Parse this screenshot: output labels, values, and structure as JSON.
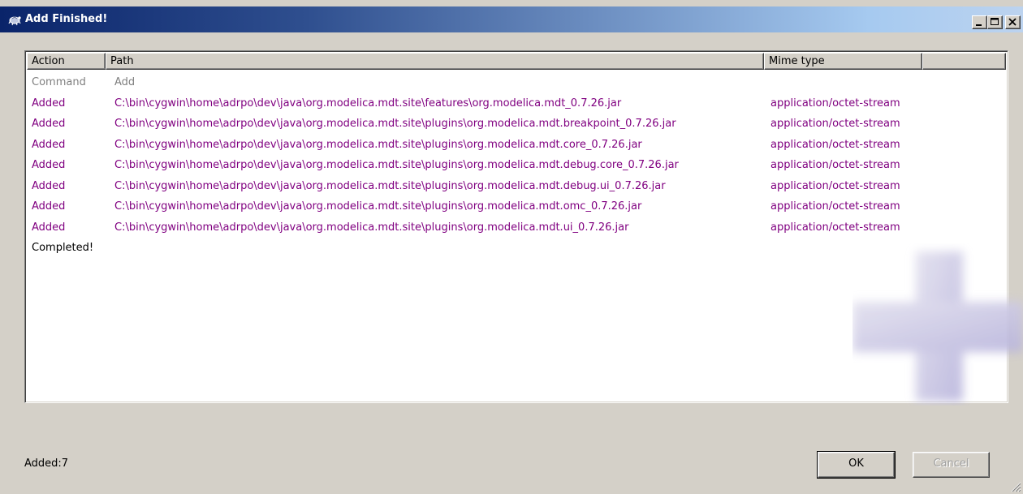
{
  "window": {
    "title": "Add Finished!",
    "icon": "tortoise-icon",
    "controls": {
      "minimize": "_",
      "maximize": "□",
      "close": "×"
    }
  },
  "list": {
    "columns": [
      "Action",
      "Path",
      "Mime type",
      ""
    ],
    "rows": [
      {
        "action": "Command",
        "path": "Add",
        "mime": "",
        "style": "gray"
      },
      {
        "action": "Added",
        "path": "C:\\bin\\cygwin\\home\\adrpo\\dev\\java\\org.modelica.mdt.site\\features\\org.modelica.mdt_0.7.26.jar",
        "mime": "application/octet-stream",
        "style": "purple"
      },
      {
        "action": "Added",
        "path": "C:\\bin\\cygwin\\home\\adrpo\\dev\\java\\org.modelica.mdt.site\\plugins\\org.modelica.mdt.breakpoint_0.7.26.jar",
        "mime": "application/octet-stream",
        "style": "purple"
      },
      {
        "action": "Added",
        "path": "C:\\bin\\cygwin\\home\\adrpo\\dev\\java\\org.modelica.mdt.site\\plugins\\org.modelica.mdt.core_0.7.26.jar",
        "mime": "application/octet-stream",
        "style": "purple"
      },
      {
        "action": "Added",
        "path": "C:\\bin\\cygwin\\home\\adrpo\\dev\\java\\org.modelica.mdt.site\\plugins\\org.modelica.mdt.debug.core_0.7.26.jar",
        "mime": "application/octet-stream",
        "style": "purple"
      },
      {
        "action": "Added",
        "path": "C:\\bin\\cygwin\\home\\adrpo\\dev\\java\\org.modelica.mdt.site\\plugins\\org.modelica.mdt.debug.ui_0.7.26.jar",
        "mime": "application/octet-stream",
        "style": "purple"
      },
      {
        "action": "Added",
        "path": "C:\\bin\\cygwin\\home\\adrpo\\dev\\java\\org.modelica.mdt.site\\plugins\\org.modelica.mdt.omc_0.7.26.jar",
        "mime": "application/octet-stream",
        "style": "purple"
      },
      {
        "action": "Added",
        "path": "C:\\bin\\cygwin\\home\\adrpo\\dev\\java\\org.modelica.mdt.site\\plugins\\org.modelica.mdt.ui_0.7.26.jar",
        "mime": "application/octet-stream",
        "style": "purple"
      },
      {
        "action": "Completed!",
        "path": "",
        "mime": "",
        "style": "black"
      }
    ],
    "watermark_icon": "plus-icon"
  },
  "footer": {
    "status": "Added:7",
    "ok_label": "OK",
    "cancel_label": "Cancel"
  },
  "colors": {
    "added": "#800080",
    "command": "#808080",
    "title_bar_start": "#0a246a",
    "title_bar_end": "#bcd3ef"
  }
}
